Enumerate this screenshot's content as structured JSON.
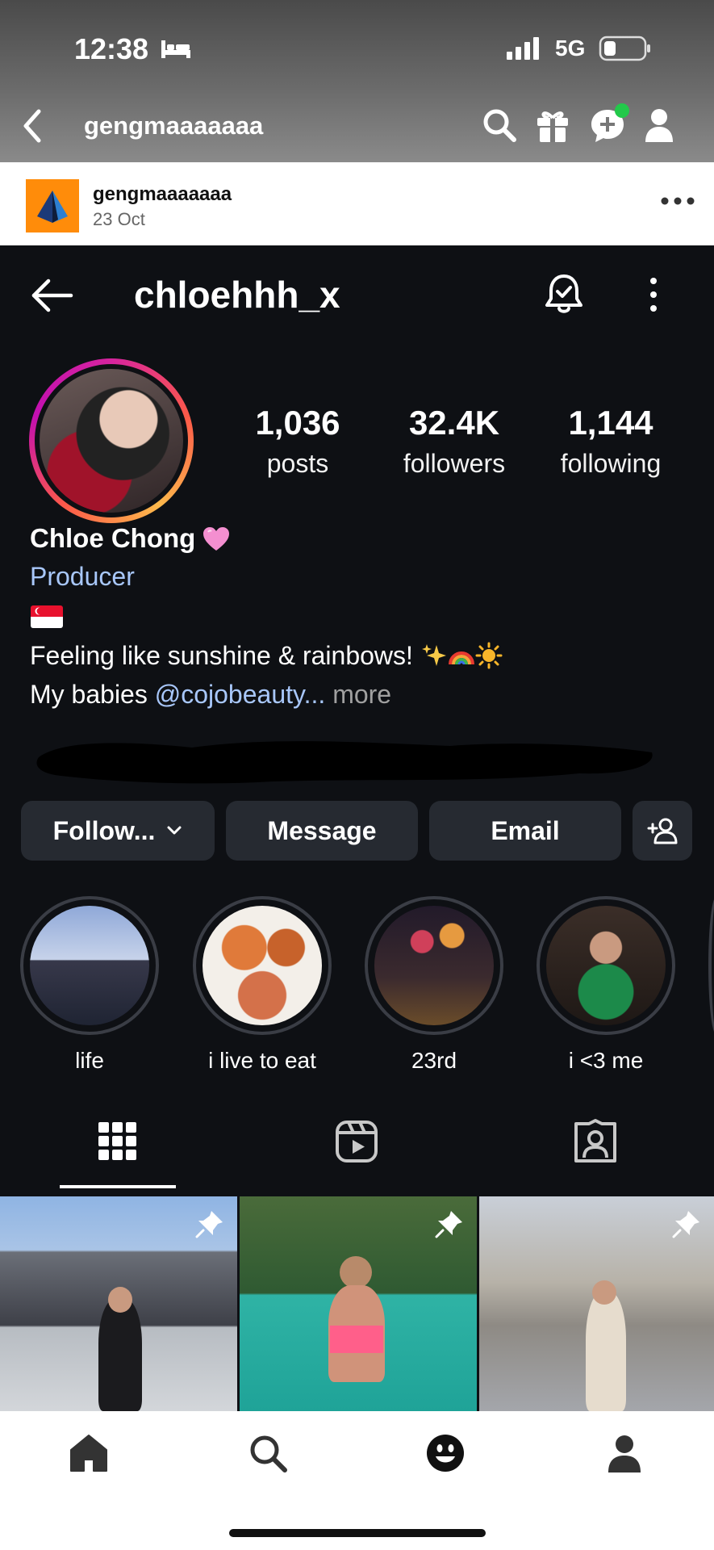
{
  "status_bar": {
    "time": "12:38",
    "network": "5G"
  },
  "app_nav": {
    "title": "gengmaaaaaaa"
  },
  "post": {
    "author": "gengmaaaaaaa",
    "date": "23 Oct"
  },
  "instagram": {
    "username": "chloehhh_x",
    "stats": [
      {
        "value": "1,036",
        "label": "posts"
      },
      {
        "value": "32.4K",
        "label": "followers"
      },
      {
        "value": "1,144",
        "label": "following"
      }
    ],
    "full_name": "Chloe Chong",
    "category": "Producer",
    "bio": {
      "line1": "Feeling like sunshine & rainbows!",
      "line2_prefix": "My babies ",
      "mention": "@cojobeauty",
      "ellipsis": "...",
      "more": " more"
    },
    "buttons": {
      "follow": "Follow...",
      "message": "Message",
      "email": "Email"
    },
    "highlights": [
      {
        "label": "life"
      },
      {
        "label": "i live to eat"
      },
      {
        "label": "23rd"
      },
      {
        "label": "i <3 me"
      }
    ],
    "tabs": [
      "grid-icon",
      "reels-icon",
      "tagged-icon"
    ]
  },
  "bottom_nav": [
    "home-icon",
    "search-icon",
    "smiley-icon",
    "profile-icon"
  ],
  "colors": {
    "accent_orange": "#ff8c0a",
    "mention_blue": "#a8c7fa",
    "ig_bg": "#0e1014",
    "notif_green": "#22c94a"
  }
}
